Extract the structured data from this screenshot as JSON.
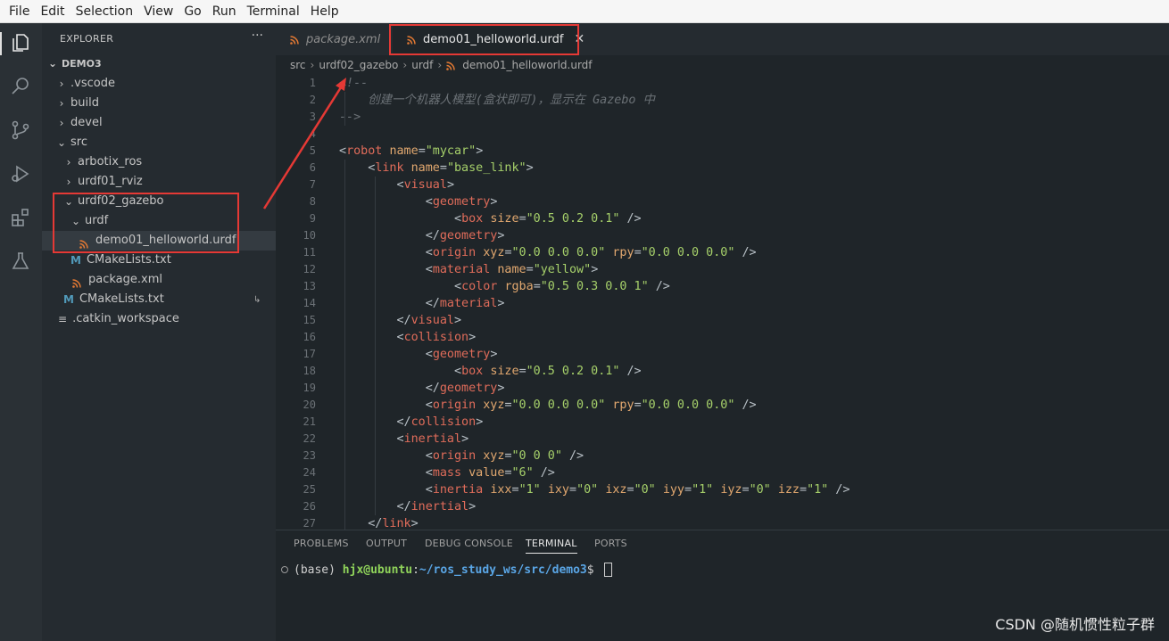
{
  "menu": [
    "File",
    "Edit",
    "Selection",
    "View",
    "Go",
    "Run",
    "Terminal",
    "Help"
  ],
  "activity_bar": {
    "icons": [
      "explorer-icon",
      "search-icon",
      "source-control-icon",
      "run-debug-icon",
      "extensions-icon",
      "testing-icon"
    ]
  },
  "sidebar": {
    "title": "EXPLORER",
    "more": "···",
    "root": "DEMO3",
    "items": [
      {
        "label": ".vscode",
        "kind": "folder",
        "open": false
      },
      {
        "label": "build",
        "kind": "folder",
        "open": false
      },
      {
        "label": "devel",
        "kind": "folder",
        "open": false
      },
      {
        "label": "src",
        "kind": "folder",
        "open": true
      },
      {
        "label": "arbotix_ros",
        "kind": "folder",
        "open": false
      },
      {
        "label": "urdf01_rviz",
        "kind": "folder",
        "open": false
      },
      {
        "label": "urdf02_gazebo",
        "kind": "folder",
        "open": true
      },
      {
        "label": "urdf",
        "kind": "folder",
        "open": true
      },
      {
        "label": "demo01_helloworld.urdf",
        "kind": "rss-file",
        "selected": true
      },
      {
        "label": "CMakeLists.txt",
        "kind": "cmake-file"
      },
      {
        "label": "package.xml",
        "kind": "rss-file"
      },
      {
        "label": "CMakeLists.txt",
        "kind": "cmake-file"
      },
      {
        "label": ".catkin_workspace",
        "kind": "lines-file"
      }
    ]
  },
  "tabs": [
    {
      "label": "package.xml",
      "active": false
    },
    {
      "label": "demo01_helloworld.urdf",
      "active": true,
      "close": "✕"
    }
  ],
  "breadcrumb": [
    "src",
    "urdf02_gazebo",
    "urdf",
    "demo01_helloworld.urdf"
  ],
  "editor": {
    "line_numbers": [
      "1",
      "2",
      "3",
      "4",
      "5",
      "6",
      "7",
      "8",
      "9",
      "10",
      "11",
      "12",
      "13",
      "14",
      "15",
      "16",
      "17",
      "18",
      "19",
      "20",
      "21",
      "22",
      "23",
      "24",
      "25",
      "26",
      "27"
    ],
    "lines": [
      [
        {
          "c": "c",
          "v": "<!--"
        }
      ],
      [
        {
          "c": "c",
          "v": "    创建一个机器人模型(盒状即可)，显示在 Gazebo 中"
        }
      ],
      [
        {
          "c": "c",
          "v": "-->"
        }
      ],
      [],
      [
        {
          "c": "p",
          "v": "<"
        },
        {
          "c": "t",
          "v": "robot"
        },
        {
          "c": "p",
          "v": " "
        },
        {
          "c": "a",
          "v": "name"
        },
        {
          "c": "p",
          "v": "="
        },
        {
          "c": "s",
          "v": "\"mycar\""
        },
        {
          "c": "p",
          "v": ">"
        }
      ],
      [
        {
          "c": "p",
          "v": "    <"
        },
        {
          "c": "t",
          "v": "link"
        },
        {
          "c": "p",
          "v": " "
        },
        {
          "c": "a",
          "v": "name"
        },
        {
          "c": "p",
          "v": "="
        },
        {
          "c": "s",
          "v": "\"base_link\""
        },
        {
          "c": "p",
          "v": ">"
        }
      ],
      [
        {
          "c": "p",
          "v": "        <"
        },
        {
          "c": "t",
          "v": "visual"
        },
        {
          "c": "p",
          "v": ">"
        }
      ],
      [
        {
          "c": "p",
          "v": "            <"
        },
        {
          "c": "t",
          "v": "geometry"
        },
        {
          "c": "p",
          "v": ">"
        }
      ],
      [
        {
          "c": "p",
          "v": "                <"
        },
        {
          "c": "t",
          "v": "box"
        },
        {
          "c": "p",
          "v": " "
        },
        {
          "c": "a",
          "v": "size"
        },
        {
          "c": "p",
          "v": "="
        },
        {
          "c": "s",
          "v": "\"0.5 0.2 0.1\""
        },
        {
          "c": "p",
          "v": " />"
        }
      ],
      [
        {
          "c": "p",
          "v": "            </"
        },
        {
          "c": "t",
          "v": "geometry"
        },
        {
          "c": "p",
          "v": ">"
        }
      ],
      [
        {
          "c": "p",
          "v": "            <"
        },
        {
          "c": "t",
          "v": "origin"
        },
        {
          "c": "p",
          "v": " "
        },
        {
          "c": "a",
          "v": "xyz"
        },
        {
          "c": "p",
          "v": "="
        },
        {
          "c": "s",
          "v": "\"0.0 0.0 0.0\""
        },
        {
          "c": "p",
          "v": " "
        },
        {
          "c": "a",
          "v": "rpy"
        },
        {
          "c": "p",
          "v": "="
        },
        {
          "c": "s",
          "v": "\"0.0 0.0 0.0\""
        },
        {
          "c": "p",
          "v": " />"
        }
      ],
      [
        {
          "c": "p",
          "v": "            <"
        },
        {
          "c": "t",
          "v": "material"
        },
        {
          "c": "p",
          "v": " "
        },
        {
          "c": "a",
          "v": "name"
        },
        {
          "c": "p",
          "v": "="
        },
        {
          "c": "s",
          "v": "\"yellow\""
        },
        {
          "c": "p",
          "v": ">"
        }
      ],
      [
        {
          "c": "p",
          "v": "                <"
        },
        {
          "c": "t",
          "v": "color"
        },
        {
          "c": "p",
          "v": " "
        },
        {
          "c": "a",
          "v": "rgba"
        },
        {
          "c": "p",
          "v": "="
        },
        {
          "c": "s",
          "v": "\"0.5 0.3 0.0 1\""
        },
        {
          "c": "p",
          "v": " />"
        }
      ],
      [
        {
          "c": "p",
          "v": "            </"
        },
        {
          "c": "t",
          "v": "material"
        },
        {
          "c": "p",
          "v": ">"
        }
      ],
      [
        {
          "c": "p",
          "v": "        </"
        },
        {
          "c": "t",
          "v": "visual"
        },
        {
          "c": "p",
          "v": ">"
        }
      ],
      [
        {
          "c": "p",
          "v": "        <"
        },
        {
          "c": "t",
          "v": "collision"
        },
        {
          "c": "p",
          "v": ">"
        }
      ],
      [
        {
          "c": "p",
          "v": "            <"
        },
        {
          "c": "t",
          "v": "geometry"
        },
        {
          "c": "p",
          "v": ">"
        }
      ],
      [
        {
          "c": "p",
          "v": "                <"
        },
        {
          "c": "t",
          "v": "box"
        },
        {
          "c": "p",
          "v": " "
        },
        {
          "c": "a",
          "v": "size"
        },
        {
          "c": "p",
          "v": "="
        },
        {
          "c": "s",
          "v": "\"0.5 0.2 0.1\""
        },
        {
          "c": "p",
          "v": " />"
        }
      ],
      [
        {
          "c": "p",
          "v": "            </"
        },
        {
          "c": "t",
          "v": "geometry"
        },
        {
          "c": "p",
          "v": ">"
        }
      ],
      [
        {
          "c": "p",
          "v": "            <"
        },
        {
          "c": "t",
          "v": "origin"
        },
        {
          "c": "p",
          "v": " "
        },
        {
          "c": "a",
          "v": "xyz"
        },
        {
          "c": "p",
          "v": "="
        },
        {
          "c": "s",
          "v": "\"0.0 0.0 0.0\""
        },
        {
          "c": "p",
          "v": " "
        },
        {
          "c": "a",
          "v": "rpy"
        },
        {
          "c": "p",
          "v": "="
        },
        {
          "c": "s",
          "v": "\"0.0 0.0 0.0\""
        },
        {
          "c": "p",
          "v": " />"
        }
      ],
      [
        {
          "c": "p",
          "v": "        </"
        },
        {
          "c": "t",
          "v": "collision"
        },
        {
          "c": "p",
          "v": ">"
        }
      ],
      [
        {
          "c": "p",
          "v": "        <"
        },
        {
          "c": "t",
          "v": "inertial"
        },
        {
          "c": "p",
          "v": ">"
        }
      ],
      [
        {
          "c": "p",
          "v": "            <"
        },
        {
          "c": "t",
          "v": "origin"
        },
        {
          "c": "p",
          "v": " "
        },
        {
          "c": "a",
          "v": "xyz"
        },
        {
          "c": "p",
          "v": "="
        },
        {
          "c": "s",
          "v": "\"0 0 0\""
        },
        {
          "c": "p",
          "v": " />"
        }
      ],
      [
        {
          "c": "p",
          "v": "            <"
        },
        {
          "c": "t",
          "v": "mass"
        },
        {
          "c": "p",
          "v": " "
        },
        {
          "c": "a",
          "v": "value"
        },
        {
          "c": "p",
          "v": "="
        },
        {
          "c": "s",
          "v": "\"6\""
        },
        {
          "c": "p",
          "v": " />"
        }
      ],
      [
        {
          "c": "p",
          "v": "            <"
        },
        {
          "c": "t",
          "v": "inertia"
        },
        {
          "c": "p",
          "v": " "
        },
        {
          "c": "a",
          "v": "ixx"
        },
        {
          "c": "p",
          "v": "="
        },
        {
          "c": "s",
          "v": "\"1\""
        },
        {
          "c": "p",
          "v": " "
        },
        {
          "c": "a",
          "v": "ixy"
        },
        {
          "c": "p",
          "v": "="
        },
        {
          "c": "s",
          "v": "\"0\""
        },
        {
          "c": "p",
          "v": " "
        },
        {
          "c": "a",
          "v": "ixz"
        },
        {
          "c": "p",
          "v": "="
        },
        {
          "c": "s",
          "v": "\"0\""
        },
        {
          "c": "p",
          "v": " "
        },
        {
          "c": "a",
          "v": "iyy"
        },
        {
          "c": "p",
          "v": "="
        },
        {
          "c": "s",
          "v": "\"1\""
        },
        {
          "c": "p",
          "v": " "
        },
        {
          "c": "a",
          "v": "iyz"
        },
        {
          "c": "p",
          "v": "="
        },
        {
          "c": "s",
          "v": "\"0\""
        },
        {
          "c": "p",
          "v": " "
        },
        {
          "c": "a",
          "v": "izz"
        },
        {
          "c": "p",
          "v": "="
        },
        {
          "c": "s",
          "v": "\"1\""
        },
        {
          "c": "p",
          "v": " />"
        }
      ],
      [
        {
          "c": "p",
          "v": "        </"
        },
        {
          "c": "t",
          "v": "inertial"
        },
        {
          "c": "p",
          "v": ">"
        }
      ],
      [
        {
          "c": "p",
          "v": "    </"
        },
        {
          "c": "t",
          "v": "link"
        },
        {
          "c": "p",
          "v": ">"
        }
      ]
    ]
  },
  "panel": {
    "tabs": [
      "PROBLEMS",
      "OUTPUT",
      "DEBUG CONSOLE",
      "TERMINAL",
      "PORTS"
    ],
    "active_tab": "TERMINAL",
    "terminal": {
      "prefix": "(base) ",
      "user": "hjx@ubuntu",
      "colon": ":",
      "path": "~/ros_study_ws/src/demo3",
      "prompt": "$ "
    }
  },
  "watermark": "CSDN @随机惯性粒子群",
  "colors": {
    "annotation": "#e53935",
    "rss_orange": "#e37933",
    "cmake_blue": "#519aba"
  }
}
